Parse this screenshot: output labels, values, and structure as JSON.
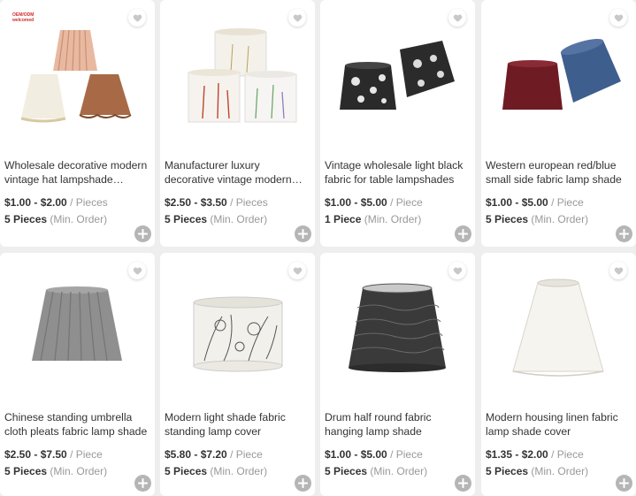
{
  "products": [
    {
      "title": "Wholesale decorative modern vintage hat lampshade…",
      "price": "$1.00 - $2.00",
      "unit": "/ Pieces",
      "moq_qty": "5 Pieces",
      "moq_label": "(Min. Order)",
      "badge": "OEM/ODM welcomed"
    },
    {
      "title": "Manufacturer luxury decorative vintage modern white tc fabri…",
      "price": "$2.50 - $3.50",
      "unit": "/ Pieces",
      "moq_qty": "5 Pieces",
      "moq_label": "(Min. Order)"
    },
    {
      "title": "Vintage wholesale light black fabric for table lampshades",
      "price": "$1.00 - $5.00",
      "unit": "/ Piece",
      "moq_qty": "1 Piece",
      "moq_label": "(Min. Order)"
    },
    {
      "title": "Western european red/blue small side fabric lamp shade",
      "price": "$1.00 - $5.00",
      "unit": "/ Piece",
      "moq_qty": "5 Pieces",
      "moq_label": "(Min. Order)"
    },
    {
      "title": "Chinese standing umbrella cloth pleats fabric lamp shade",
      "price": "$2.50 - $7.50",
      "unit": "/ Piece",
      "moq_qty": "5 Pieces",
      "moq_label": "(Min. Order)"
    },
    {
      "title": "Modern light shade fabric standing lamp cover",
      "price": "$5.80 - $7.20",
      "unit": "/ Piece",
      "moq_qty": "5 Pieces",
      "moq_label": "(Min. Order)"
    },
    {
      "title": "Drum half round fabric hanging lamp shade",
      "price": "$1.00 - $5.00",
      "unit": "/ Piece",
      "moq_qty": "5 Pieces",
      "moq_label": "(Min. Order)"
    },
    {
      "title": "Modern housing linen fabric lamp shade cover",
      "price": "$1.35 - $2.00",
      "unit": "/ Piece",
      "moq_qty": "5 Pieces",
      "moq_label": "(Min. Order)"
    }
  ],
  "icons": {
    "favorite": "heart-icon",
    "add": "plus-icon"
  },
  "colors": {
    "add_button": "#b5b5b5",
    "price_text": "#333333",
    "muted_text": "#999999",
    "badge_red": "#d02b2b"
  }
}
